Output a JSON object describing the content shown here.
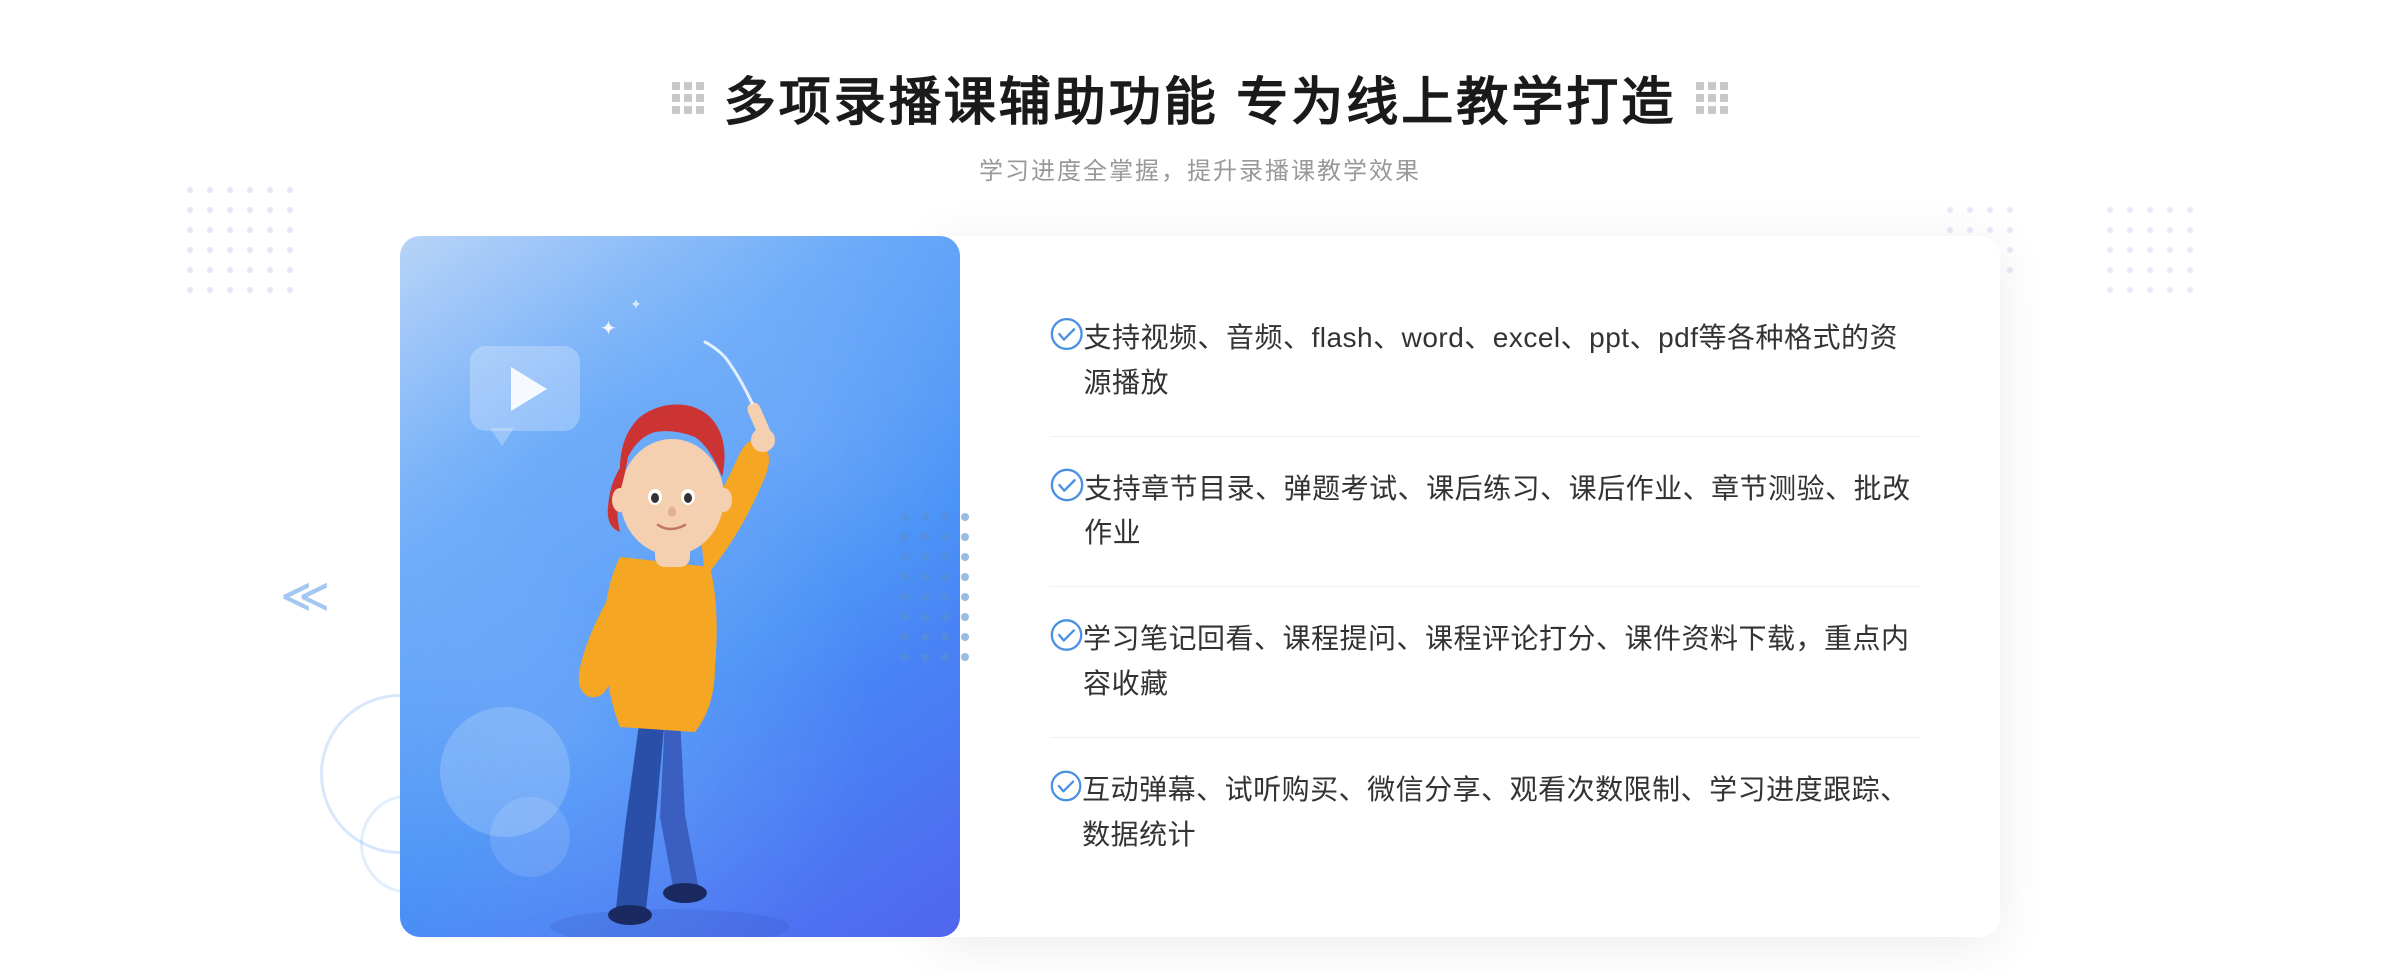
{
  "header": {
    "title": "多项录播课辅助功能 专为线上教学打造",
    "subtitle": "学习进度全掌握，提升录播课教学效果"
  },
  "features": [
    {
      "id": 1,
      "text": "支持视频、音频、flash、word、excel、ppt、pdf等各种格式的资源播放"
    },
    {
      "id": 2,
      "text": "支持章节目录、弹题考试、课后练习、课后作业、章节测验、批改作业"
    },
    {
      "id": 3,
      "text": "学习笔记回看、课程提问、课程评论打分、课件资料下载，重点内容收藏"
    },
    {
      "id": 4,
      "text": "互动弹幕、试听购买、微信分享、观看次数限制、学习进度跟踪、数据统计"
    }
  ],
  "colors": {
    "accent": "#4a90e2",
    "gradient_start": "#b8d4f8",
    "gradient_end": "#5065f0",
    "text_primary": "#333333",
    "text_secondary": "#888888",
    "check_color": "#4a90e2"
  }
}
